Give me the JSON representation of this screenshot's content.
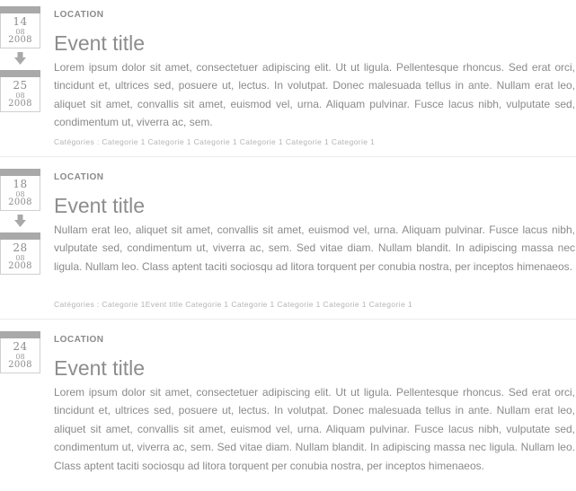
{
  "events": [
    {
      "start": {
        "day": "14",
        "month": "08",
        "year": "2008"
      },
      "end": {
        "day": "25",
        "month": "08",
        "year": "2008"
      },
      "location": "LOCATION",
      "title": "Event title",
      "description": "Lorem ipsum dolor sit amet, consectetuer adipiscing elit. Ut ut ligula. Pellentesque rhoncus. Sed erat orci, tincidunt et, ultrices sed, posuere ut, lectus. In volutpat. Donec malesuada tellus in ante. Nullam erat leo, aliquet sit amet, convallis sit amet, euismod vel, urna. Aliquam pulvinar. Fusce lacus nibh, vulputate sed, condimentum ut, viverra ac, sem.",
      "categories": "Catégories : Categorie 1 Categorie 1 Categorie 1 Categorie 1 Categorie 1 Categorie 1"
    },
    {
      "start": {
        "day": "18",
        "month": "08",
        "year": "2008"
      },
      "end": {
        "day": "28",
        "month": "08",
        "year": "2008"
      },
      "location": "LOCATION",
      "title": "Event title",
      "description": "Nullam erat leo, aliquet sit amet, convallis sit amet, euismod vel, urna. Aliquam pulvinar. Fusce lacus nibh, vulputate sed, condimentum ut, viverra ac, sem. Sed vitae diam. Nullam blandit. In adipiscing massa nec ligula. Nullam leo. Class aptent taciti sociosqu ad litora torquent per conubia nostra, per inceptos himenaeos.",
      "categories": "Catégories : Categorie 1Event title Categorie 1 Categorie 1 Categorie 1 Categorie 1 Categorie 1"
    },
    {
      "start": {
        "day": "24",
        "month": "08",
        "year": "2008"
      },
      "location": "LOCATION",
      "title": "Event title",
      "description": "Lorem ipsum dolor sit amet, consectetuer adipiscing elit. Ut ut ligula. Pellentesque rhoncus. Sed erat orci, tincidunt et, ultrices sed, posuere ut, lectus. In volutpat. Donec malesuada tellus in ante. Nullam erat leo, aliquet sit amet, convallis sit amet, euismod vel, urna. Aliquam pulvinar. Fusce lacus nibh, vulputate sed, condimentum ut, viverra ac, sem. Sed vitae diam. Nullam blandit. In adipiscing massa nec ligula. Nullam leo. Class aptent taciti sociosqu ad litora torquent per conubia nostra, per inceptos himenaeos."
    }
  ],
  "icons": {
    "range_arrow": "arrow-down-icon",
    "calendar": "calendar-icon"
  },
  "colors": {
    "calendar_bar": "#a9a9a9",
    "text": "#8a8a8a",
    "categories": "#b4b4b4",
    "separator": "#ececec"
  }
}
